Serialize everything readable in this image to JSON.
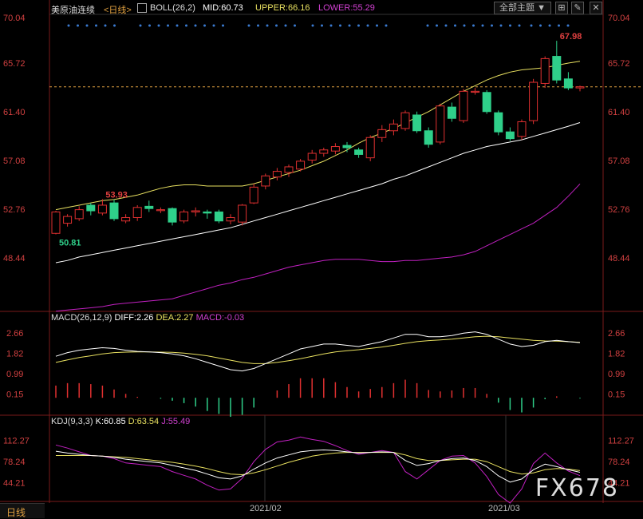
{
  "header": {
    "symbol": "美原油连续",
    "period": "<日线>",
    "boll": {
      "label": "BOLL(26,2)",
      "mid": "MID:60.73",
      "upper": "UPPER:66.16",
      "lower": "LOWER:55.29"
    },
    "theme_button": "全部主题",
    "theme_arrow": "▼"
  },
  "macd_header": {
    "label": "MACD(26,12,9)",
    "diff": "DIFF:2.26",
    "dea": "DEA:2.27",
    "macd": "MACD:-0.03"
  },
  "kdj_header": {
    "label": "KDJ(9,3,3)",
    "k": "K:60.85",
    "d": "D:63.54",
    "j": "J:55.49"
  },
  "footer": {
    "period_tab": "日线",
    "dates": [
      "2021/02",
      "2021/03"
    ]
  },
  "watermark": "FX678",
  "colors": {
    "up": "#e03030",
    "down": "#2fd08a",
    "mid": "#ffffff",
    "band": "#e8e060",
    "lower": "#c020c0",
    "axis": "#d04040"
  },
  "chart_data": {
    "type": "candlestick",
    "price_axis": {
      "ticks": [
        "70.04",
        "65.72",
        "61.40",
        "57.08",
        "52.76",
        "48.44"
      ],
      "ylim": [
        44.12,
        70.04
      ]
    },
    "annotations": {
      "high_max": "67.98",
      "label_5393": "53.93",
      "low_min": "50.81"
    },
    "current_price": 63.9,
    "candles": [
      {
        "o": 50.9,
        "c": 52.8,
        "h": 52.9,
        "l": 50.81
      },
      {
        "o": 51.8,
        "c": 52.4,
        "h": 52.6,
        "l": 51.5
      },
      {
        "o": 52.2,
        "c": 53.0,
        "h": 53.3,
        "l": 52.0
      },
      {
        "o": 53.4,
        "c": 52.9,
        "h": 53.6,
        "l": 52.5
      },
      {
        "o": 52.7,
        "c": 53.4,
        "h": 53.93,
        "l": 52.5
      },
      {
        "o": 53.6,
        "c": 52.2,
        "h": 53.9,
        "l": 52.0
      },
      {
        "o": 52.0,
        "c": 52.3,
        "h": 52.6,
        "l": 51.8
      },
      {
        "o": 52.3,
        "c": 53.2,
        "h": 53.4,
        "l": 52.0
      },
      {
        "o": 53.3,
        "c": 53.1,
        "h": 53.8,
        "l": 52.8
      },
      {
        "o": 53.0,
        "c": 53.0,
        "h": 53.2,
        "l": 52.7
      },
      {
        "o": 53.1,
        "c": 51.9,
        "h": 53.2,
        "l": 51.6
      },
      {
        "o": 52.0,
        "c": 52.8,
        "h": 53.0,
        "l": 51.8
      },
      {
        "o": 52.8,
        "c": 52.9,
        "h": 53.2,
        "l": 52.4
      },
      {
        "o": 52.8,
        "c": 52.7,
        "h": 53.0,
        "l": 52.2
      },
      {
        "o": 52.8,
        "c": 52.0,
        "h": 53.0,
        "l": 51.8
      },
      {
        "o": 52.0,
        "c": 52.3,
        "h": 52.6,
        "l": 51.7
      },
      {
        "o": 51.9,
        "c": 53.4,
        "h": 53.5,
        "l": 51.6
      },
      {
        "o": 53.6,
        "c": 55.0,
        "h": 55.3,
        "l": 53.5
      },
      {
        "o": 55.1,
        "c": 56.0,
        "h": 56.2,
        "l": 54.8
      },
      {
        "o": 55.9,
        "c": 56.4,
        "h": 56.7,
        "l": 55.6
      },
      {
        "o": 56.3,
        "c": 56.8,
        "h": 57.0,
        "l": 55.9
      },
      {
        "o": 56.6,
        "c": 57.3,
        "h": 57.5,
        "l": 56.4
      },
      {
        "o": 57.4,
        "c": 58.0,
        "h": 58.3,
        "l": 57.1
      },
      {
        "o": 58.0,
        "c": 58.3,
        "h": 58.5,
        "l": 57.7
      },
      {
        "o": 58.2,
        "c": 58.6,
        "h": 58.9,
        "l": 57.9
      },
      {
        "o": 58.7,
        "c": 58.5,
        "h": 59.0,
        "l": 58.1
      },
      {
        "o": 58.3,
        "c": 57.9,
        "h": 58.5,
        "l": 57.6
      },
      {
        "o": 57.6,
        "c": 59.4,
        "h": 59.6,
        "l": 57.3
      },
      {
        "o": 59.4,
        "c": 60.1,
        "h": 60.5,
        "l": 59.0
      },
      {
        "o": 60.0,
        "c": 60.6,
        "h": 61.0,
        "l": 59.6
      },
      {
        "o": 60.2,
        "c": 61.6,
        "h": 61.8,
        "l": 60.0
      },
      {
        "o": 61.4,
        "c": 60.0,
        "h": 61.7,
        "l": 59.8
      },
      {
        "o": 60.0,
        "c": 58.8,
        "h": 60.3,
        "l": 58.5
      },
      {
        "o": 59.0,
        "c": 62.2,
        "h": 62.4,
        "l": 58.8
      },
      {
        "o": 62.1,
        "c": 61.1,
        "h": 62.5,
        "l": 60.8
      },
      {
        "o": 60.9,
        "c": 63.5,
        "h": 63.7,
        "l": 60.7
      },
      {
        "o": 63.5,
        "c": 63.5,
        "h": 63.8,
        "l": 63.2
      },
      {
        "o": 63.4,
        "c": 61.7,
        "h": 63.6,
        "l": 61.5
      },
      {
        "o": 61.6,
        "c": 59.9,
        "h": 61.8,
        "l": 59.6
      },
      {
        "o": 59.9,
        "c": 59.3,
        "h": 60.3,
        "l": 59.1
      },
      {
        "o": 59.5,
        "c": 60.8,
        "h": 61.0,
        "l": 59.2
      },
      {
        "o": 60.9,
        "c": 64.3,
        "h": 64.6,
        "l": 60.6
      },
      {
        "o": 64.2,
        "c": 66.4,
        "h": 66.6,
        "l": 63.8
      },
      {
        "o": 66.6,
        "c": 64.5,
        "h": 67.98,
        "l": 64.2
      },
      {
        "o": 64.6,
        "c": 63.8,
        "h": 65.2,
        "l": 63.6
      },
      {
        "o": 63.8,
        "c": 63.9,
        "h": 64.0,
        "l": 63.5
      }
    ],
    "boll_upper": [
      53.0,
      53.2,
      53.4,
      53.6,
      53.8,
      53.9,
      54.1,
      54.3,
      54.6,
      54.9,
      55.1,
      55.2,
      55.2,
      55.1,
      55.1,
      55.1,
      55.1,
      55.3,
      55.6,
      55.9,
      56.2,
      56.5,
      56.9,
      57.3,
      57.8,
      58.3,
      58.9,
      59.4,
      59.8,
      60.2,
      60.7,
      61.2,
      61.7,
      62.3,
      62.9,
      63.5,
      64.0,
      64.5,
      64.9,
      65.2,
      65.4,
      65.5,
      65.6,
      65.8,
      66.0,
      66.16
    ],
    "boll_mid": [
      48.3,
      48.5,
      48.8,
      49.0,
      49.2,
      49.4,
      49.6,
      49.8,
      50.0,
      50.2,
      50.4,
      50.6,
      50.8,
      51.0,
      51.2,
      51.4,
      51.7,
      52.0,
      52.3,
      52.6,
      52.9,
      53.2,
      53.5,
      53.8,
      54.1,
      54.4,
      54.7,
      55.0,
      55.3,
      55.7,
      56.0,
      56.4,
      56.8,
      57.2,
      57.6,
      58.0,
      58.3,
      58.6,
      58.8,
      59.0,
      59.2,
      59.5,
      59.8,
      60.1,
      60.4,
      60.73
    ],
    "boll_lower": [
      44.0,
      44.1,
      44.2,
      44.3,
      44.4,
      44.6,
      44.7,
      44.8,
      44.9,
      45.0,
      45.1,
      45.4,
      45.7,
      46.0,
      46.3,
      46.5,
      46.8,
      47.0,
      47.3,
      47.6,
      47.9,
      48.1,
      48.3,
      48.5,
      48.6,
      48.6,
      48.6,
      48.5,
      48.4,
      48.4,
      48.5,
      48.5,
      48.6,
      48.7,
      48.8,
      49.0,
      49.3,
      49.8,
      50.3,
      50.8,
      51.3,
      51.8,
      52.5,
      53.2,
      54.2,
      55.29
    ],
    "macd_axis": {
      "ticks": [
        "2.66",
        "1.82",
        "0.99",
        "0.15"
      ],
      "ylim": [
        -0.55,
        2.95
      ]
    },
    "macd_diff": [
      1.7,
      1.85,
      1.95,
      2.0,
      2.05,
      2.02,
      1.95,
      1.9,
      1.88,
      1.85,
      1.8,
      1.72,
      1.6,
      1.45,
      1.3,
      1.15,
      1.1,
      1.2,
      1.4,
      1.6,
      1.8,
      2.0,
      2.1,
      2.2,
      2.2,
      2.15,
      2.1,
      2.2,
      2.3,
      2.45,
      2.6,
      2.6,
      2.5,
      2.5,
      2.55,
      2.65,
      2.7,
      2.6,
      2.4,
      2.2,
      2.1,
      2.15,
      2.3,
      2.35,
      2.3,
      2.26
    ],
    "macd_dea": [
      1.45,
      1.55,
      1.65,
      1.72,
      1.8,
      1.85,
      1.87,
      1.88,
      1.88,
      1.87,
      1.86,
      1.83,
      1.78,
      1.72,
      1.63,
      1.54,
      1.45,
      1.4,
      1.4,
      1.45,
      1.52,
      1.6,
      1.7,
      1.8,
      1.88,
      1.93,
      1.97,
      2.02,
      2.08,
      2.15,
      2.23,
      2.3,
      2.34,
      2.37,
      2.4,
      2.45,
      2.5,
      2.52,
      2.5,
      2.45,
      2.4,
      2.35,
      2.33,
      2.32,
      2.3,
      2.27
    ],
    "macd_hist": [
      0.5,
      0.6,
      0.6,
      0.56,
      0.5,
      0.34,
      0.16,
      0.04,
      0.0,
      -0.04,
      -0.12,
      -0.22,
      -0.36,
      -0.54,
      -0.66,
      -0.78,
      -0.7,
      -0.4,
      0.0,
      0.3,
      0.56,
      0.8,
      0.8,
      0.8,
      0.64,
      0.44,
      0.26,
      0.36,
      0.44,
      0.6,
      0.74,
      0.6,
      0.32,
      0.26,
      0.3,
      0.4,
      0.4,
      0.16,
      -0.2,
      -0.5,
      -0.6,
      -0.4,
      -0.06,
      0.06,
      0.0,
      -0.03
    ],
    "kdj_axis": {
      "ticks": [
        "112.27",
        "78.24",
        "44.21"
      ],
      "ylim": [
        15,
        130
      ]
    },
    "kdj_k": [
      95,
      92,
      90,
      88,
      87,
      85,
      82,
      80,
      78,
      76,
      72,
      68,
      64,
      58,
      52,
      50,
      55,
      66,
      76,
      84,
      89,
      94,
      96,
      97,
      96,
      94,
      92,
      93,
      94,
      93,
      80,
      72,
      75,
      80,
      83,
      84,
      80,
      70,
      55,
      45,
      50,
      65,
      74,
      70,
      65,
      60.85
    ],
    "kdj_d": [
      88,
      88,
      88,
      88,
      87,
      86,
      85,
      83,
      81,
      79,
      77,
      74,
      71,
      67,
      62,
      58,
      57,
      60,
      65,
      71,
      77,
      82,
      87,
      90,
      92,
      93,
      93,
      93,
      93,
      93,
      89,
      83,
      80,
      80,
      81,
      82,
      82,
      78,
      70,
      62,
      58,
      60,
      65,
      67,
      66,
      63.54
    ],
    "kdj_j": [
      105,
      100,
      94,
      88,
      87,
      83,
      76,
      74,
      72,
      70,
      62,
      56,
      50,
      40,
      32,
      34,
      51,
      78,
      98,
      110,
      113,
      118,
      114,
      111,
      104,
      96,
      90,
      93,
      96,
      93,
      62,
      50,
      65,
      80,
      87,
      88,
      76,
      54,
      25,
      11,
      34,
      75,
      92,
      76,
      63,
      55.49
    ]
  }
}
